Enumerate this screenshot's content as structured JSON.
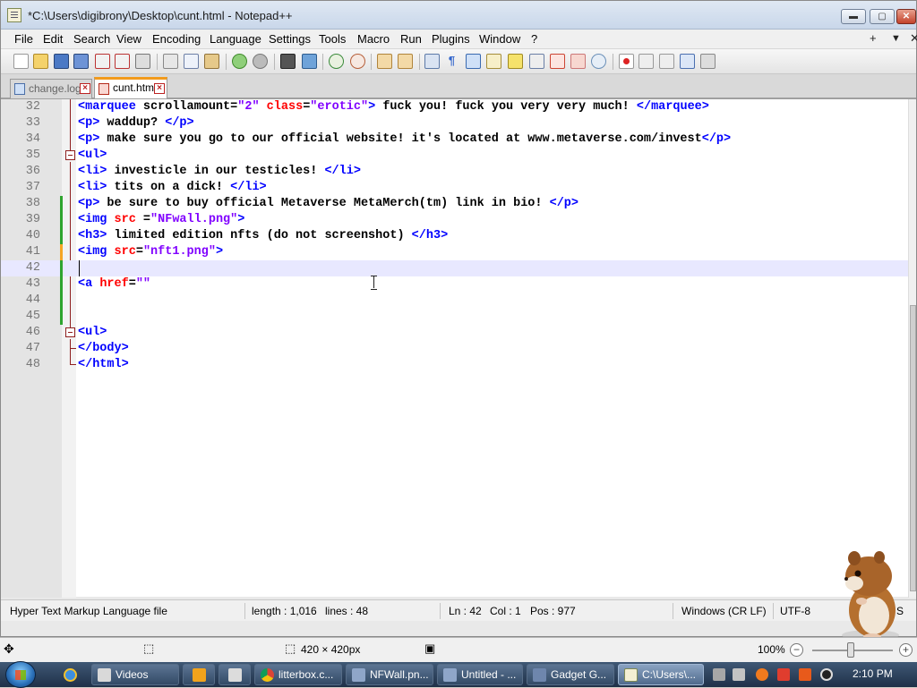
{
  "window": {
    "title": "*C:\\Users\\digibrony\\Desktop\\cunt.html - Notepad++",
    "controls": {
      "minimize": "▬",
      "maximize": "▢",
      "close": "✕"
    }
  },
  "menu": {
    "items": [
      "File",
      "Edit",
      "Search",
      "View",
      "Encoding",
      "Language",
      "Settings",
      "Tools",
      "Macro",
      "Run",
      "Plugins",
      "Window",
      "?"
    ],
    "right": {
      "add": "+",
      "dropdown": "▼",
      "close": "✕"
    }
  },
  "tabs": [
    {
      "label": "change.log",
      "active": false
    },
    {
      "label": "cunt.html",
      "active": true
    }
  ],
  "editor": {
    "lines": [
      {
        "n": "32",
        "parts": [
          [
            "tag",
            "<marquee "
          ],
          [
            "text",
            "scrollamount="
          ],
          [
            "val",
            "\"2\""
          ],
          [
            "text",
            " "
          ],
          [
            "attr",
            "class"
          ],
          [
            "text",
            "="
          ],
          [
            "val",
            "\"erotic\""
          ],
          [
            "tag",
            ">"
          ],
          [
            "text",
            " fuck you! fuck you very very much! "
          ],
          [
            "tag",
            "</marquee>"
          ]
        ]
      },
      {
        "n": "33",
        "parts": [
          [
            "tag",
            "<p>"
          ],
          [
            "text",
            " waddup? "
          ],
          [
            "tag",
            "</p>"
          ]
        ]
      },
      {
        "n": "34",
        "parts": [
          [
            "tag",
            "<p>"
          ],
          [
            "text",
            " make sure you go to our official website! it's located at www.metaverse.com/invest"
          ],
          [
            "tag",
            "</p>"
          ]
        ]
      },
      {
        "n": "35",
        "parts": [
          [
            "tag",
            "<ul>"
          ]
        ]
      },
      {
        "n": "36",
        "parts": [
          [
            "tag",
            "<li>"
          ],
          [
            "text",
            " investicle in our testicles! "
          ],
          [
            "tag",
            "</li>"
          ]
        ]
      },
      {
        "n": "37",
        "parts": [
          [
            "tag",
            "<li>"
          ],
          [
            "text",
            " tits on a dick! "
          ],
          [
            "tag",
            "</li>"
          ]
        ]
      },
      {
        "n": "38",
        "parts": [
          [
            "tag",
            "<p>"
          ],
          [
            "text",
            " be sure to buy official Metaverse MetaMerch(tm) link in bio! "
          ],
          [
            "tag",
            "</p>"
          ]
        ]
      },
      {
        "n": "39",
        "parts": [
          [
            "tag",
            "<img "
          ],
          [
            "attr",
            "src"
          ],
          [
            "text",
            " ="
          ],
          [
            "val",
            "\"NFwall.png\""
          ],
          [
            "tag",
            ">"
          ]
        ]
      },
      {
        "n": "40",
        "parts": [
          [
            "tag",
            "<h3>"
          ],
          [
            "text",
            " limited edition nfts (do not screenshot) "
          ],
          [
            "tag",
            "</h3>"
          ]
        ]
      },
      {
        "n": "41",
        "parts": [
          [
            "tag",
            "<img "
          ],
          [
            "attr",
            "src"
          ],
          [
            "text",
            "="
          ],
          [
            "val",
            "\"nft1.png\""
          ],
          [
            "tag",
            ">"
          ]
        ]
      },
      {
        "n": "42",
        "parts": []
      },
      {
        "n": "43",
        "parts": [
          [
            "tag",
            "<a "
          ],
          [
            "attr",
            "href"
          ],
          [
            "text",
            "="
          ],
          [
            "val",
            "\"\""
          ]
        ]
      },
      {
        "n": "44",
        "parts": []
      },
      {
        "n": "45",
        "parts": []
      },
      {
        "n": "46",
        "parts": [
          [
            "tag",
            "<ul>"
          ]
        ]
      },
      {
        "n": "47",
        "parts": [
          [
            "tag",
            "</body>"
          ]
        ]
      },
      {
        "n": "48",
        "parts": [
          [
            "tag",
            "</html>"
          ]
        ]
      }
    ]
  },
  "status": {
    "filetype": "Hyper Text Markup Language file",
    "length": "length : 1,016",
    "lines": "lines : 48",
    "ln": "Ln : 42",
    "col": "Col : 1",
    "pos": "Pos : 977",
    "eol": "Windows (CR LF)",
    "encoding": "UTF-8",
    "mode": "S"
  },
  "viewer": {
    "dimensions": "420 × 420px",
    "zoom": "100%"
  },
  "taskbar": {
    "items": [
      {
        "label": "Videos"
      },
      {
        "label": ""
      },
      {
        "label": ""
      },
      {
        "label": "litterbox.c..."
      },
      {
        "label": "NFWall.pn..."
      },
      {
        "label": "Untitled - ..."
      },
      {
        "label": "Gadget G..."
      },
      {
        "label": "C:\\Users\\..."
      }
    ],
    "clock": "2:10 PM"
  },
  "colors": {
    "tag": "#0000ff",
    "attr": "#ff0000",
    "value": "#8000ff",
    "tab_accent": "#f29b1d",
    "saved_change": "#2fa52f",
    "unsaved_change": "#f5a623"
  }
}
